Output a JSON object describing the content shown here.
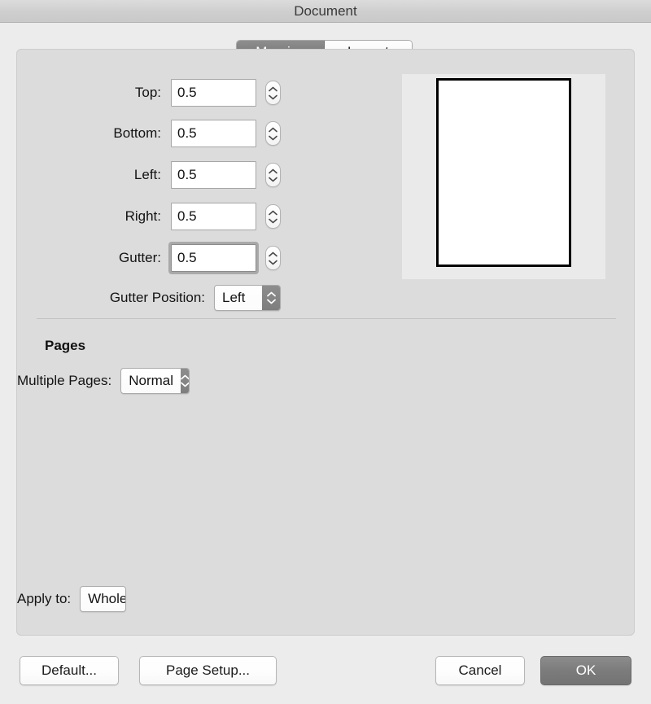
{
  "window": {
    "title": "Document"
  },
  "tabs": [
    {
      "label": "Margins",
      "selected": true
    },
    {
      "label": "Layout",
      "selected": false
    }
  ],
  "margins": {
    "fields": [
      {
        "label": "Top:",
        "value": "0.5",
        "focused": false
      },
      {
        "label": "Bottom:",
        "value": "0.5",
        "focused": false
      },
      {
        "label": "Left:",
        "value": "0.5",
        "focused": false
      },
      {
        "label": "Right:",
        "value": "0.5",
        "focused": false
      },
      {
        "label": "Gutter:",
        "value": "0.5",
        "focused": true
      }
    ],
    "gutter_position": {
      "label": "Gutter Position:",
      "value": "Left"
    }
  },
  "pages": {
    "heading": "Pages",
    "multiple_pages": {
      "label": "Multiple Pages:",
      "value": "Normal"
    }
  },
  "apply_to": {
    "label": "Apply to:",
    "value": "Whole document"
  },
  "buttons": {
    "default": "Default...",
    "page_setup": "Page Setup...",
    "cancel": "Cancel",
    "ok": "OK"
  },
  "colors": {
    "window_background": "#ececec",
    "panel_background": "#dcdcdc",
    "titlebar": "#cfcfcf",
    "selected_tab": "#7d7d7d",
    "default_button": "#7c7c7c",
    "preview_background": "#eaeaea",
    "page_border": "#000000"
  }
}
